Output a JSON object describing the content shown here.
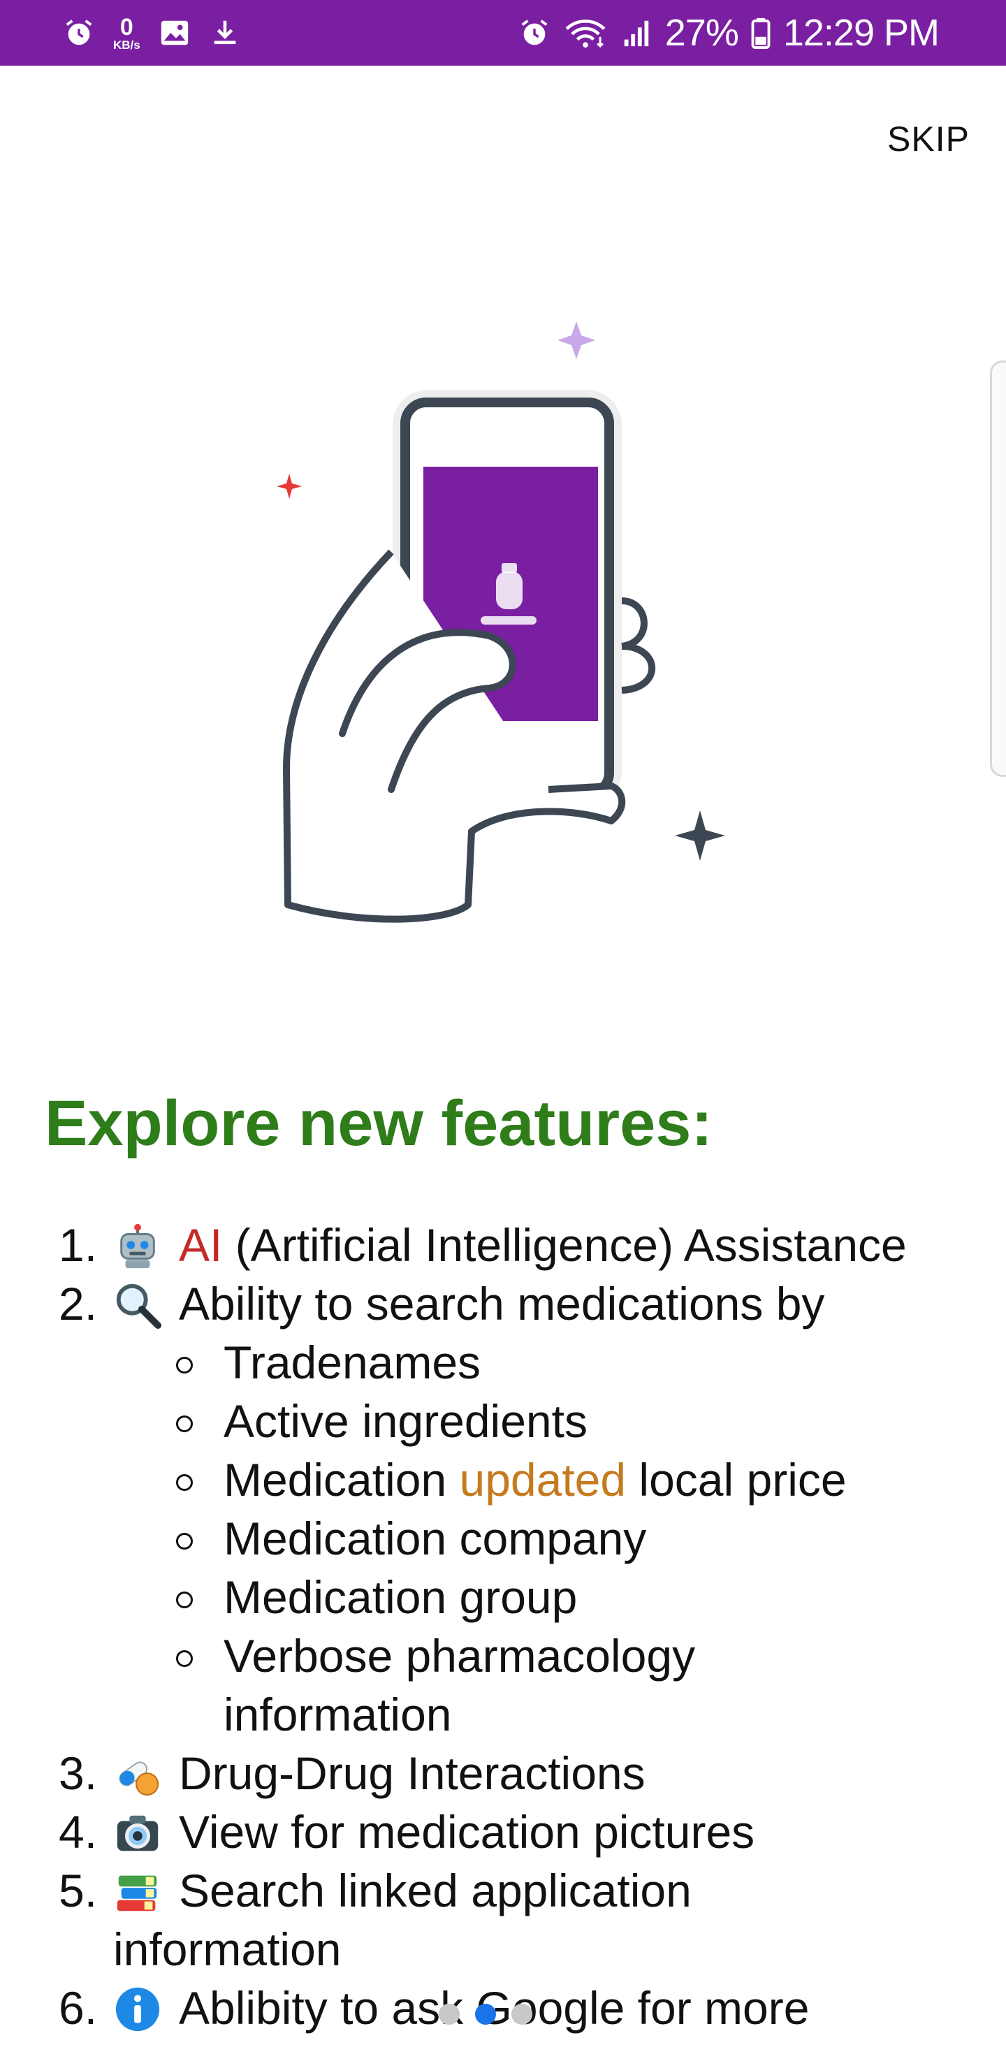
{
  "status_bar": {
    "network_speed_value": "0",
    "network_speed_unit": "KB/s",
    "battery_percent": "27%",
    "time": "12:29 PM",
    "icons": [
      "alarm-icon",
      "kbs-indicator",
      "image-icon",
      "download-icon",
      "alarm-icon",
      "wifi-icon",
      "signal-icon",
      "battery-icon"
    ],
    "background_color": "#7b1fa2"
  },
  "onboarding": {
    "skip_label": "SKIP",
    "headline": "Explore new features:",
    "headline_color": "#2e7d1a",
    "features": [
      {
        "number": "1.",
        "icon": "robot-icon",
        "highlight": "AI",
        "text": " (Artificial Intelligence) Assistance"
      },
      {
        "number": "2.",
        "icon": "magnifier-icon",
        "text": "Ability to search medications by"
      },
      {
        "number": "3.",
        "icon": "pills-icon",
        "text": "Drug-Drug Interactions"
      },
      {
        "number": "4.",
        "icon": "camera-icon",
        "text": "View for medication pictures"
      },
      {
        "number": "5.",
        "icon": "books-icon",
        "text": "Search linked application",
        "continuation": "information"
      },
      {
        "number": "6.",
        "icon": "info-icon",
        "text": "Ablibity to ask Google for more"
      }
    ],
    "search_by": {
      "tradenames": "Tradenames",
      "active_ingredients": "Active ingredients",
      "price_before": "Medication ",
      "price_highlight": "updated",
      "price_after": " local price",
      "company": "Medication company",
      "group": "Medication group",
      "pharmacology": "Verbose pharmacology",
      "pharmacology_cont": "information"
    },
    "highlight_colors": {
      "ai": "#c62828",
      "updated": "#c67a1f"
    }
  },
  "pager": {
    "page_count": 3,
    "active_index": 1,
    "active_color": "#1a73e8"
  }
}
